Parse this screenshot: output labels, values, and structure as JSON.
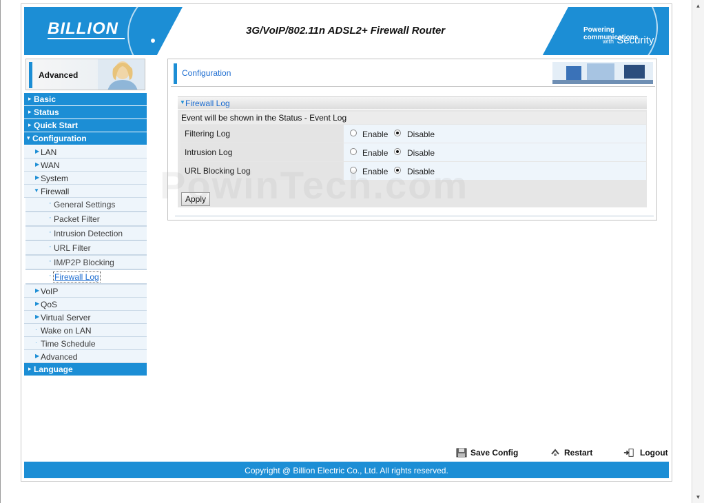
{
  "header": {
    "logo": "BILLION",
    "product_title": "3G/VoIP/802.11n ADSL2+ Firewall Router",
    "slogan_line1": "Powering communications",
    "slogan_with": "with",
    "slogan_line2": "Security"
  },
  "side_banner": {
    "label": "Advanced"
  },
  "menu": {
    "basic": "Basic",
    "status": "Status",
    "quick_start": "Quick Start",
    "configuration": "Configuration",
    "lan": "LAN",
    "wan": "WAN",
    "system": "System",
    "firewall": "Firewall",
    "general_settings": "General Settings",
    "packet_filter": "Packet Filter",
    "intrusion_detection": "Intrusion Detection",
    "url_filter": "URL Filter",
    "im_p2p_blocking": "IM/P2P Blocking",
    "firewall_log": "Firewall Log",
    "voip": "VoIP",
    "qos": "QoS",
    "virtual_server": "Virtual Server",
    "wake_on_lan": "Wake on LAN",
    "time_schedule": "Time Schedule",
    "advanced": "Advanced",
    "language": "Language"
  },
  "content": {
    "section_title": "Configuration",
    "panel_title": "Firewall Log",
    "note": "Event will be shown in the Status - Event Log",
    "rows": [
      {
        "label": "Filtering Log",
        "enable": "Enable",
        "disable": "Disable",
        "selected": "Disable"
      },
      {
        "label": "Intrusion Log",
        "enable": "Enable",
        "disable": "Disable",
        "selected": "Disable"
      },
      {
        "label": "URL Blocking Log",
        "enable": "Enable",
        "disable": "Disable",
        "selected": "Disable"
      }
    ],
    "apply_label": "Apply"
  },
  "watermark": "PowinTech.com",
  "actions": {
    "save_config": "Save Config",
    "restart": "Restart",
    "logout": "Logout"
  },
  "footer": {
    "copyright": "Copyright @ Billion Electric Co., Ltd. All rights reserved."
  },
  "colors": {
    "brand_blue": "#1c8ed5",
    "link_blue": "#1c6cd0"
  }
}
